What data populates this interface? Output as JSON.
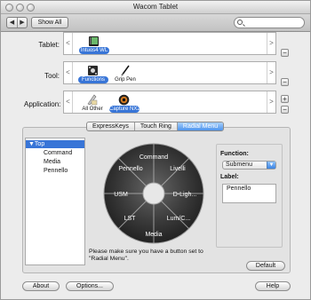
{
  "window": {
    "title": "Wacom Tablet"
  },
  "toolbar": {
    "show_all_label": "Show All"
  },
  "rows": {
    "tablet": {
      "label": "Tablet:",
      "items": [
        {
          "name": "Intuos4 WL",
          "selected": true
        }
      ]
    },
    "tool": {
      "label": "Tool:",
      "items": [
        {
          "name": "Functions",
          "selected": true
        },
        {
          "name": "Grip Pen",
          "selected": false
        }
      ]
    },
    "application": {
      "label": "Application:",
      "items": [
        {
          "name": "All Other",
          "selected": false
        },
        {
          "name": "Capture NX2",
          "selected": true
        }
      ]
    }
  },
  "buttons": {
    "minus": "−",
    "plus": "+",
    "default": "Default",
    "about": "About",
    "options": "Options...",
    "help": "Help"
  },
  "tabs": [
    {
      "label": "ExpressKeys",
      "active": false
    },
    {
      "label": "Touch Ring",
      "active": false
    },
    {
      "label": "Radial Menu",
      "active": true
    }
  ],
  "tree": {
    "top": "▼Top",
    "children": [
      "Command",
      "Media",
      "Pennello"
    ]
  },
  "radial_menu": {
    "segments": [
      "Command",
      "Livelli",
      "D-Ligh...",
      "Lum/C...",
      "Media",
      "LST",
      "USM",
      "Pennello"
    ]
  },
  "note": "Please make sure you have a button set to \"Radial Menu\".",
  "function_panel": {
    "function_label": "Function:",
    "function_value": "Submenu",
    "label_label": "Label:",
    "label_value": "Pennello"
  },
  "colors": {
    "selection_blue": "#3875d7",
    "tab_active": "#4d93ea"
  }
}
